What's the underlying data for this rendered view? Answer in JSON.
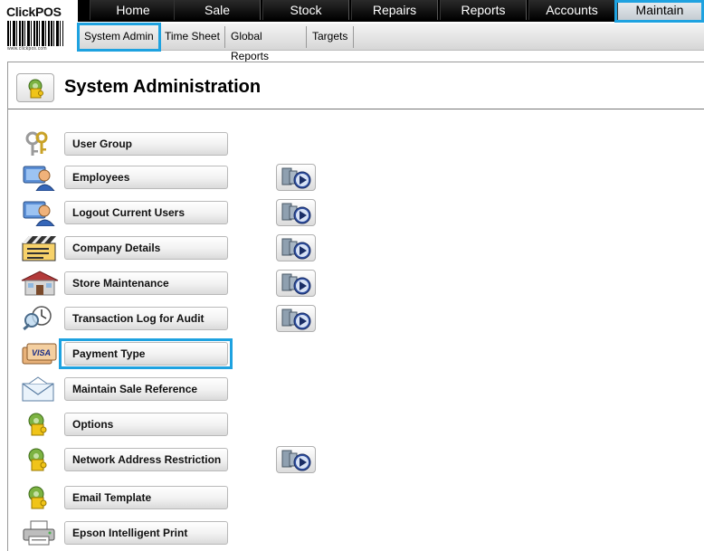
{
  "logo": {
    "brand_click": "Click",
    "brand_pos": "POS",
    "url": "www.clickpos.com"
  },
  "topnav": {
    "tabs": [
      {
        "label": "Home"
      },
      {
        "label": "Sale"
      },
      {
        "label": "Stock"
      },
      {
        "label": "Repairs"
      },
      {
        "label": "Reports"
      },
      {
        "label": "Accounts"
      },
      {
        "label": "Maintain"
      }
    ],
    "active": "Maintain"
  },
  "subnav": {
    "tabs": [
      {
        "label": "System Admin"
      },
      {
        "label": "Time Sheet"
      },
      {
        "label": "Global Reports"
      },
      {
        "label": "Targets"
      }
    ],
    "active": "System Admin"
  },
  "page": {
    "title": "System Administration",
    "header_icon": "puzzle-gear-icon"
  },
  "items": [
    {
      "label": "User Group",
      "icon": "keys-icon",
      "video": false
    },
    {
      "label": "Employees",
      "icon": "user-icon",
      "video": true
    },
    {
      "label": "Logout Current Users",
      "icon": "user-icon",
      "video": true
    },
    {
      "label": "Company Details",
      "icon": "clapperboard-icon",
      "video": true
    },
    {
      "label": "Store Maintenance",
      "icon": "store-icon",
      "video": true
    },
    {
      "label": "Transaction Log for Audit",
      "icon": "clock-magnifier-icon",
      "video": true
    },
    {
      "label": "Payment Type",
      "icon": "visa-card-icon",
      "video": false,
      "highlighted": true
    },
    {
      "label": "Maintain Sale Reference",
      "icon": "envelope-icon",
      "video": false
    },
    {
      "label": "Options",
      "icon": "puzzle-gear-icon",
      "video": false
    },
    {
      "label": "Network Address Restriction",
      "icon": "puzzle-gear-icon",
      "video": true
    },
    {
      "label": "Email Template",
      "icon": "puzzle-gear-icon",
      "video": false
    },
    {
      "label": "Epson Intelligent Print",
      "icon": "printer-icon",
      "video": false
    }
  ],
  "colors": {
    "highlight": "#1ea2e0",
    "nav_bg": "#000000",
    "active_tab": "#d8dee3"
  }
}
